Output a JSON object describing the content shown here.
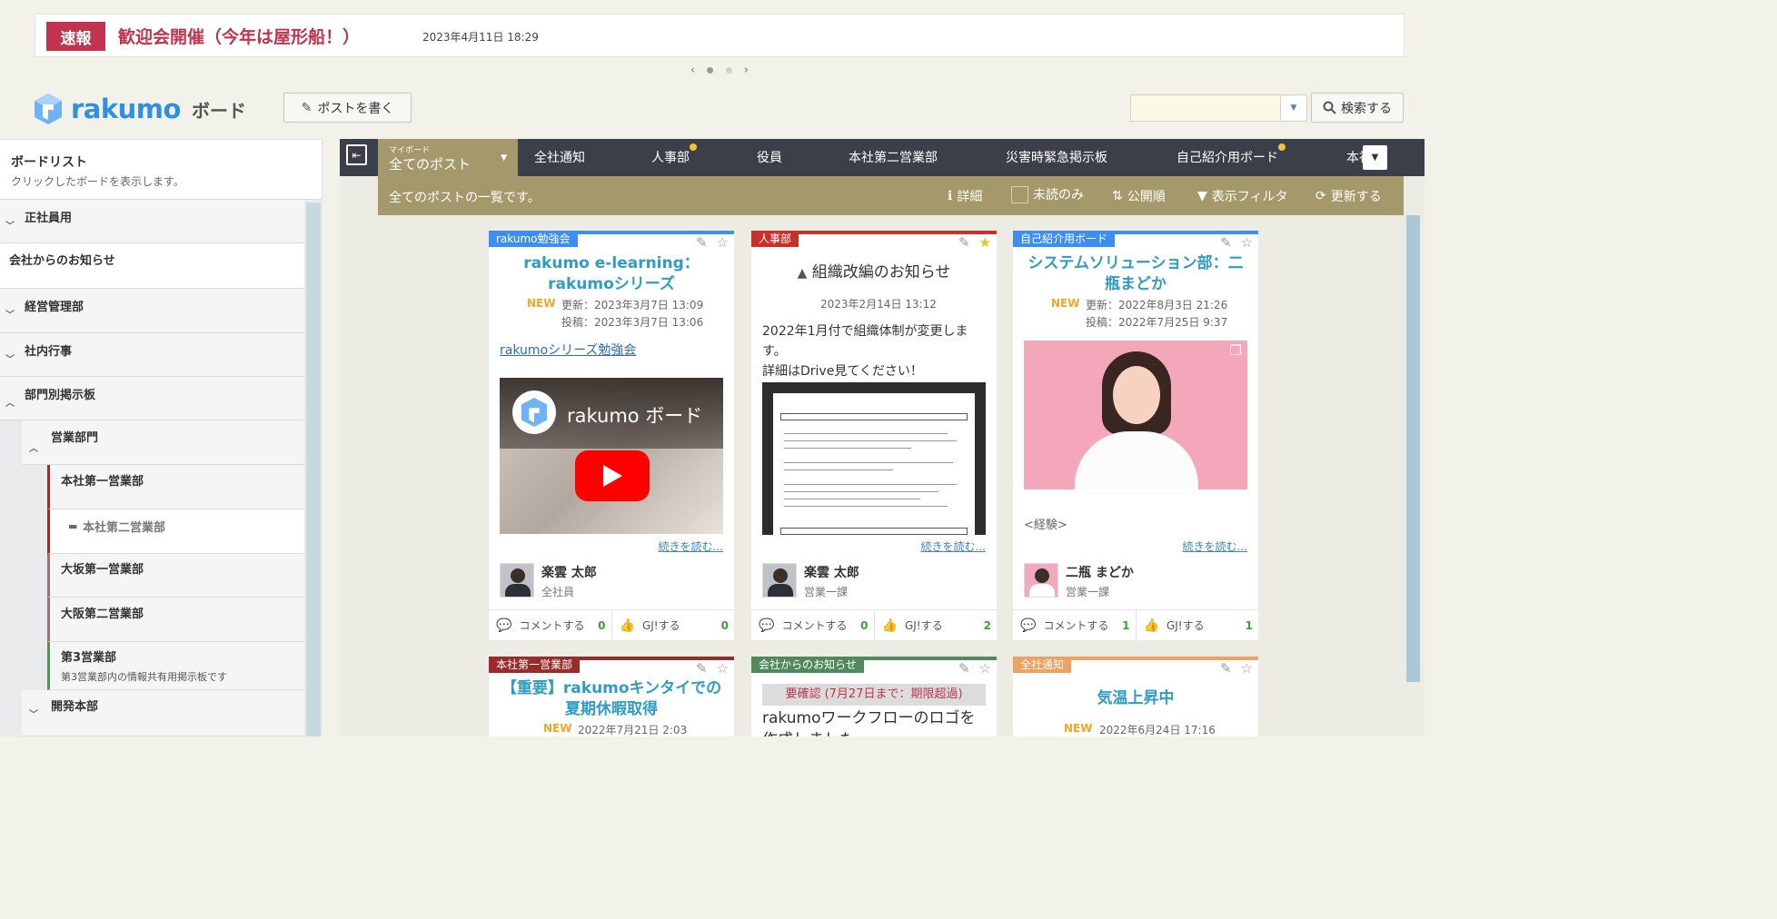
{
  "banner": {
    "badge": "速報",
    "title": "歓迎会開催（今年は屋形船！）",
    "date": "2023年4月11日 18:29",
    "prev": "‹",
    "next": "›"
  },
  "header": {
    "logo_text": "rakumo",
    "logo_sub": "ボード",
    "write_button": "ポストを書く",
    "search_button": "検索する",
    "search_value": ""
  },
  "sidebar": {
    "title": "ボードリスト",
    "subtitle": "クリックしたボードを表示します。",
    "items": [
      {
        "label": "正社員用"
      },
      {
        "label": "会社からのお知らせ"
      },
      {
        "label": "経営管理部"
      },
      {
        "label": "社内行事"
      },
      {
        "label": "部門別掲示板"
      },
      {
        "label": "営業部門"
      },
      {
        "label": "本社第一営業部"
      },
      {
        "label": "本社第二営業部"
      },
      {
        "label": "大坂第一営業部"
      },
      {
        "label": "大阪第二営業部"
      },
      {
        "label": "第3営業部",
        "desc": "第3営業部内の情報共有用掲示板です"
      },
      {
        "label": "開発本部"
      }
    ]
  },
  "tabs": {
    "active_small": "マイボード",
    "active_label": "全てのポスト",
    "items": [
      "全社通知",
      "人事部",
      "役員",
      "本社第二営業部",
      "災害時緊急掲示板",
      "自己紹介用ボード",
      "本社"
    ]
  },
  "subbar": {
    "text": "全てのポストの一覧です。",
    "detail": "詳細",
    "unread": "未読のみ",
    "public": "公開順",
    "filter": "表示フィルタ",
    "refresh": "更新する"
  },
  "colors": {
    "accent_red": "#c2344d",
    "brand_blue": "#2f8fe0",
    "tab_bar": "#3a3f4a",
    "tab_active": "#a5996b",
    "unread_dot": "#f4c430"
  },
  "cards": [
    {
      "tag": "rakumo勉強会",
      "tag_color": "#3d8ef0",
      "title": "rakumo e-learning：rakumoシリーズ",
      "new": "NEW",
      "updated": "更新：2023年3月7日 13:09",
      "posted": "投稿：2023年3月7日 13:06",
      "link": "rakumoシリーズ勉強会",
      "video_title": "rakumo ボード",
      "read_more": "続きを読む...",
      "author": "楽雲 太郎",
      "dept": "全社員",
      "comment": "コメントする",
      "comment_count": "0",
      "gj": "GJ!する",
      "gj_count": "0"
    },
    {
      "tag": "人事部",
      "tag_color": "#c9302c",
      "title": "組織改編のお知らせ",
      "date": "2023年2月14日 13:12",
      "body1": "2022年1月付で組織体制が変更します。",
      "body2": "詳細はDrive見てください！",
      "read_more": "続きを読む...",
      "author": "楽雲 太郎",
      "dept": "営業一課",
      "comment": "コメントする",
      "comment_count": "0",
      "gj": "GJ!する",
      "gj_count": "2"
    },
    {
      "tag": "自己紹介用ボード",
      "tag_color": "#3d8ef0",
      "title": "システムソリューション部：二瓶まどか",
      "new": "NEW",
      "updated": "更新：2022年8月3日 21:26",
      "posted": "投稿：2022年7月25日 9:37",
      "excerpt": "<経験>",
      "read_more": "続きを読む...",
      "author": "二瓶 まどか",
      "dept": "営業一課",
      "comment": "コメントする",
      "comment_count": "1",
      "gj": "GJ!する",
      "gj_count": "1"
    },
    {
      "tag": "本社第一営業部",
      "tag_color": "#9b2a2a",
      "title": "【重要】rakumoキンタイでの夏期休暇取得",
      "new": "NEW",
      "updated": "2022年7月21日 2:03"
    },
    {
      "tag": "会社からのお知らせ",
      "tag_color": "#4f8a5b",
      "confirm": "要確認 (7月27日まで：期限超過)",
      "title": "rakumoワークフローのロゴを作成しました"
    },
    {
      "tag": "全社通知",
      "tag_color": "#f0a060",
      "title": "気温上昇中",
      "new": "NEW",
      "updated": "2022年6月24日 17:16"
    }
  ]
}
